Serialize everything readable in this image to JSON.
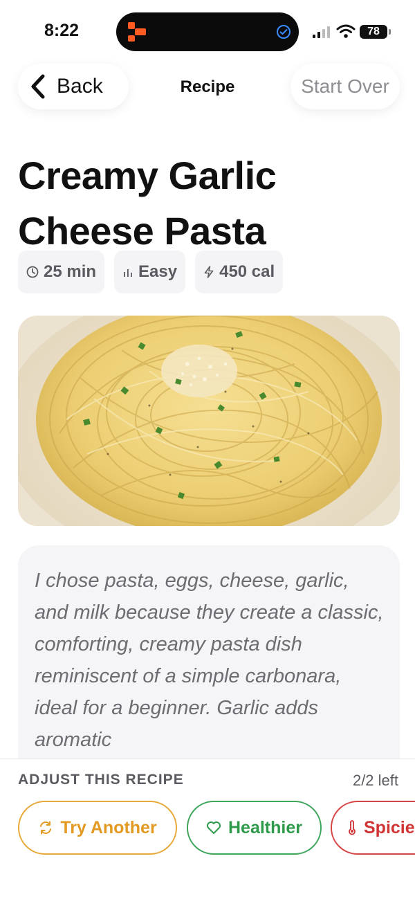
{
  "status_bar": {
    "time": "8:22",
    "battery": "78"
  },
  "nav": {
    "back_label": "Back",
    "title": "Recipe",
    "start_over_label": "Start Over"
  },
  "recipe": {
    "title_line1": "Creamy Garlic",
    "title_line2": "Cheese Pasta",
    "meta": [
      {
        "icon": "clock-icon",
        "label": "25 min"
      },
      {
        "icon": "bar-chart-icon",
        "label": "Easy"
      },
      {
        "icon": "bolt-icon",
        "label": "450 cal"
      }
    ],
    "reason": "I chose pasta, eggs, cheese, garlic, and milk because they create a classic, comforting, creamy pasta dish reminiscent of a simple carbonara, ideal for a beginner. Garlic adds aromatic"
  },
  "adjust": {
    "label": "ADJUST THIS RECIPE",
    "remaining": "2/2 left",
    "buttons": [
      {
        "label": "Try Another",
        "icon": "refresh-icon",
        "color": "#e39a23"
      },
      {
        "label": "Healthier",
        "icon": "heart-icon",
        "color": "#2f9a4c"
      },
      {
        "label": "Spicier",
        "icon": "thermometer-icon",
        "color": "#d03434"
      }
    ]
  },
  "colors": {
    "accent_orange": "#e39a23",
    "accent_green": "#2f9a4c",
    "accent_red": "#d03434"
  }
}
